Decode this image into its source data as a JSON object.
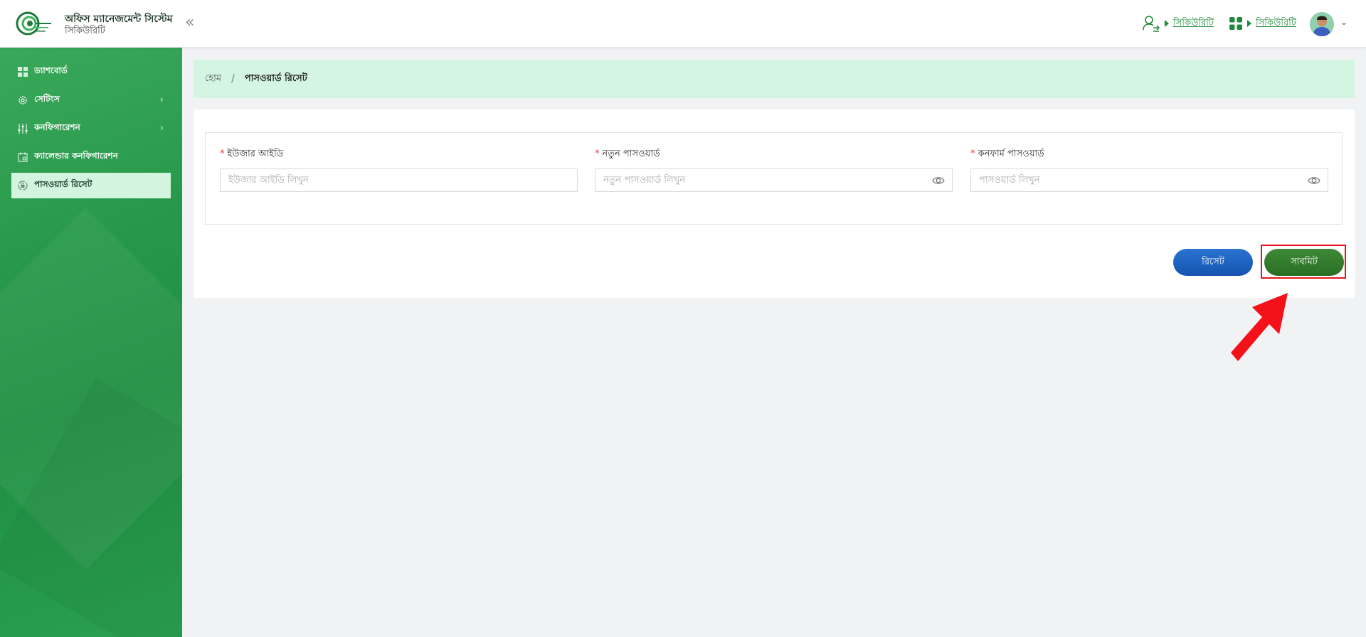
{
  "header": {
    "app_title": "অফিস ম্যানেজমেন্ট সিস্টেম",
    "app_subtitle": "সিকিউরিটি",
    "role_link": "সিকিউরিটি",
    "module_link": "সিকিউরিটি"
  },
  "sidebar": {
    "items": [
      {
        "label": "ড্যাশবোর্ড"
      },
      {
        "label": "সেটিংস"
      },
      {
        "label": "কনফিগারেশন"
      },
      {
        "label": "ক্যালেন্ডার কনফিগারেশন"
      },
      {
        "label": "পাসওয়ার্ড রিসেট"
      }
    ]
  },
  "breadcrumb": {
    "home": "হোম",
    "separator": "/",
    "current": "পাসওয়ার্ড রিসেট"
  },
  "form": {
    "user_id": {
      "label": "ইউজার আইডি",
      "placeholder": "ইউজার আইডি লিখুন",
      "value": ""
    },
    "new_password": {
      "label": "নতুন পাসওয়ার্ড",
      "placeholder": "নতুন পাসওয়ার্ড লিখুন",
      "value": ""
    },
    "confirm_password": {
      "label": "কনফার্ম পাসওয়ার্ড",
      "placeholder": "পাসওয়ার্ড লিখুন",
      "value": ""
    },
    "required_mark": "*"
  },
  "buttons": {
    "reset": "রিসেট",
    "submit": "সাবমিট"
  },
  "colors": {
    "brand_green": "#1d8a3a",
    "active_item_bg": "#d3f5e0",
    "reset_blue": "#1e63c0",
    "submit_green": "#357d2e",
    "highlight_red": "#e8131c"
  }
}
